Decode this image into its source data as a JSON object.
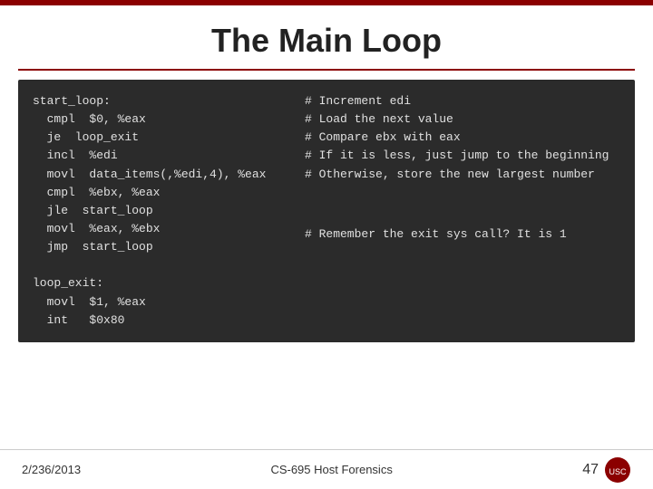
{
  "title": "The Main Loop",
  "code": {
    "left_block": "start_loop:\n  cmpl  $0, %eax\n  je  loop_exit\n  incl  %edi\n  movl  data_items(,%edi,4), %eax\n  cmpl  %ebx, %eax\n  jle  start_loop\n  movl  %eax, %ebx\n  jmp  start_loop\n\nloop_exit:\n  movl  $1, %eax\n  int   $0x80",
    "right_top": "# Increment edi\n# Load the next value\n# Compare ebx with eax\n# If it is less, just jump to the beginning\n# Otherwise, store the new largest number",
    "right_bottom": "# Remember the exit sys call? It is 1"
  },
  "footer": {
    "date": "2/236/2013",
    "course": "CS-695 Host Forensics",
    "page": "47"
  }
}
